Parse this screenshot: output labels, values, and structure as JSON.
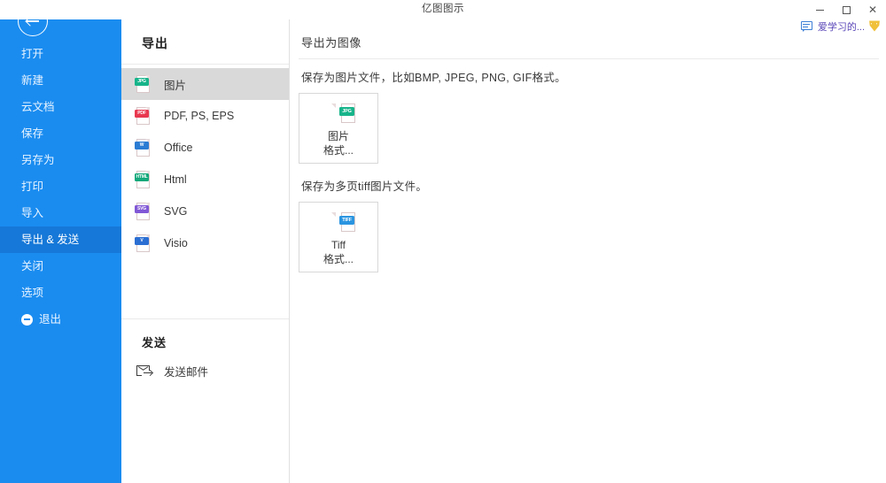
{
  "titlebar": {
    "title": "亿图图示",
    "minimize_label": "最小化",
    "maximize_label": "最大化",
    "close_label": "关闭"
  },
  "account": {
    "name": "爱学习的...",
    "chat_icon": "chat-icon",
    "vip_icon": "vip-badge-icon"
  },
  "sidebar": {
    "back_label": "返回",
    "bg_color": "#1a8cf0",
    "selected_bg_color": "#1678d8",
    "items": [
      {
        "label": "打开",
        "selected": false
      },
      {
        "label": "新建",
        "selected": false
      },
      {
        "label": "云文档",
        "selected": false
      },
      {
        "label": "保存",
        "selected": false
      },
      {
        "label": "另存为",
        "selected": false
      },
      {
        "label": "打印",
        "selected": false
      },
      {
        "label": "导入",
        "selected": false
      },
      {
        "label": "导出 & 发送",
        "selected": true
      },
      {
        "label": "关闭",
        "selected": false
      },
      {
        "label": "选项",
        "selected": false
      },
      {
        "label": "退出",
        "selected": false,
        "icon": "exit-icon"
      }
    ]
  },
  "middle": {
    "export_heading": "导出",
    "formats": [
      {
        "label": "图片",
        "tag": "JPG",
        "color": "#18b48a",
        "selected": true
      },
      {
        "label": "PDF, PS, EPS",
        "tag": "PDF",
        "color": "#e8384f",
        "selected": false
      },
      {
        "label": "Office",
        "tag": "W",
        "color": "#2b7cd3",
        "selected": false
      },
      {
        "label": "Html",
        "tag": "HTML",
        "color": "#14a87a",
        "selected": false
      },
      {
        "label": "SVG",
        "tag": "SVG",
        "color": "#8158d6",
        "selected": false
      },
      {
        "label": "Visio",
        "tag": "V",
        "color": "#2b6fd3",
        "selected": false
      }
    ],
    "send_heading": "发送",
    "send_mail_label": "发送邮件"
  },
  "content": {
    "title": "导出为图像",
    "description_1": "保存为图片文件，比如BMP, JPEG, PNG, GIF格式。",
    "description_2": "保存为多页tiff图片文件。",
    "tiles": [
      {
        "line1": "图片",
        "line2": "格式...",
        "tag": "JPG",
        "color": "#18b48a"
      },
      {
        "line1": "Tiff",
        "line2": "格式...",
        "tag": "TIFF",
        "color": "#2b95e0"
      }
    ]
  }
}
